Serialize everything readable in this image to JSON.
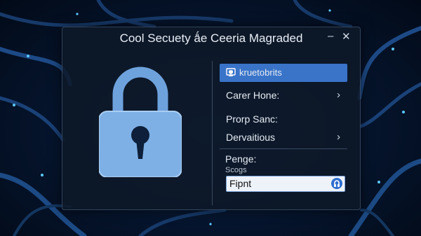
{
  "window": {
    "title": "Cool Secuety ǻe Ceeria Magraded",
    "controls": {
      "minimize": "–",
      "close": "✕"
    }
  },
  "menu": {
    "items": [
      {
        "label": "kruetobrits",
        "icon": "shield-icon",
        "active": true
      },
      {
        "label": "Carer Hone:",
        "chevron": "›"
      },
      {
        "label": "Prorp Sanc:"
      },
      {
        "label": "Dervaitious",
        "chevron": "›"
      }
    ]
  },
  "settings": {
    "title": "Penge:",
    "subtitle": "Scogs",
    "field_value": "Fipnt"
  },
  "colors": {
    "accent": "#3a74c9",
    "window_bg": "#0e1828",
    "lock": "#7eb0e6"
  }
}
